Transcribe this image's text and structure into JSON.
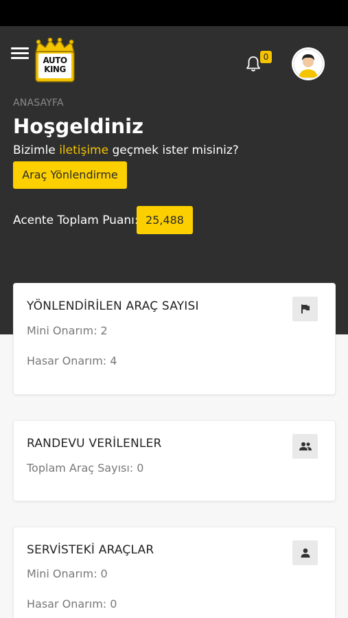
{
  "header": {
    "logo_line1": "AUTO",
    "logo_line2": "KING",
    "notifications_count": "0"
  },
  "hero": {
    "breadcrumb": "ANASAYFA",
    "title": "Hoşgeldiniz",
    "contact_prefix": "Bizimle ",
    "contact_link": "iletişime",
    "contact_suffix": " geçmek ister misiniz?",
    "redirect_button": "Araç Yönlendirme",
    "score_label": "Acente Toplam Puanı:",
    "score_value": "25,488"
  },
  "cards": [
    {
      "title": "YÖNLENDİRİLEN ARAÇ SAYISI",
      "icon": "flag-icon",
      "lines": [
        "Mini Onarım: 2",
        "Hasar Onarım: 4"
      ]
    },
    {
      "title": "RANDEVU VERİLENLER",
      "icon": "people-icon",
      "lines": [
        "Toplam Araç Sayısı: 0"
      ]
    },
    {
      "title": "SERVİSTEKİ ARAÇLAR",
      "icon": "person-icon",
      "lines": [
        "Mini Onarım: 0",
        "Hasar Onarım: 0"
      ]
    }
  ],
  "colors": {
    "accent": "#fcd000",
    "header_bg": "#2f2f2f",
    "page_bg": "#f7f7f7"
  }
}
